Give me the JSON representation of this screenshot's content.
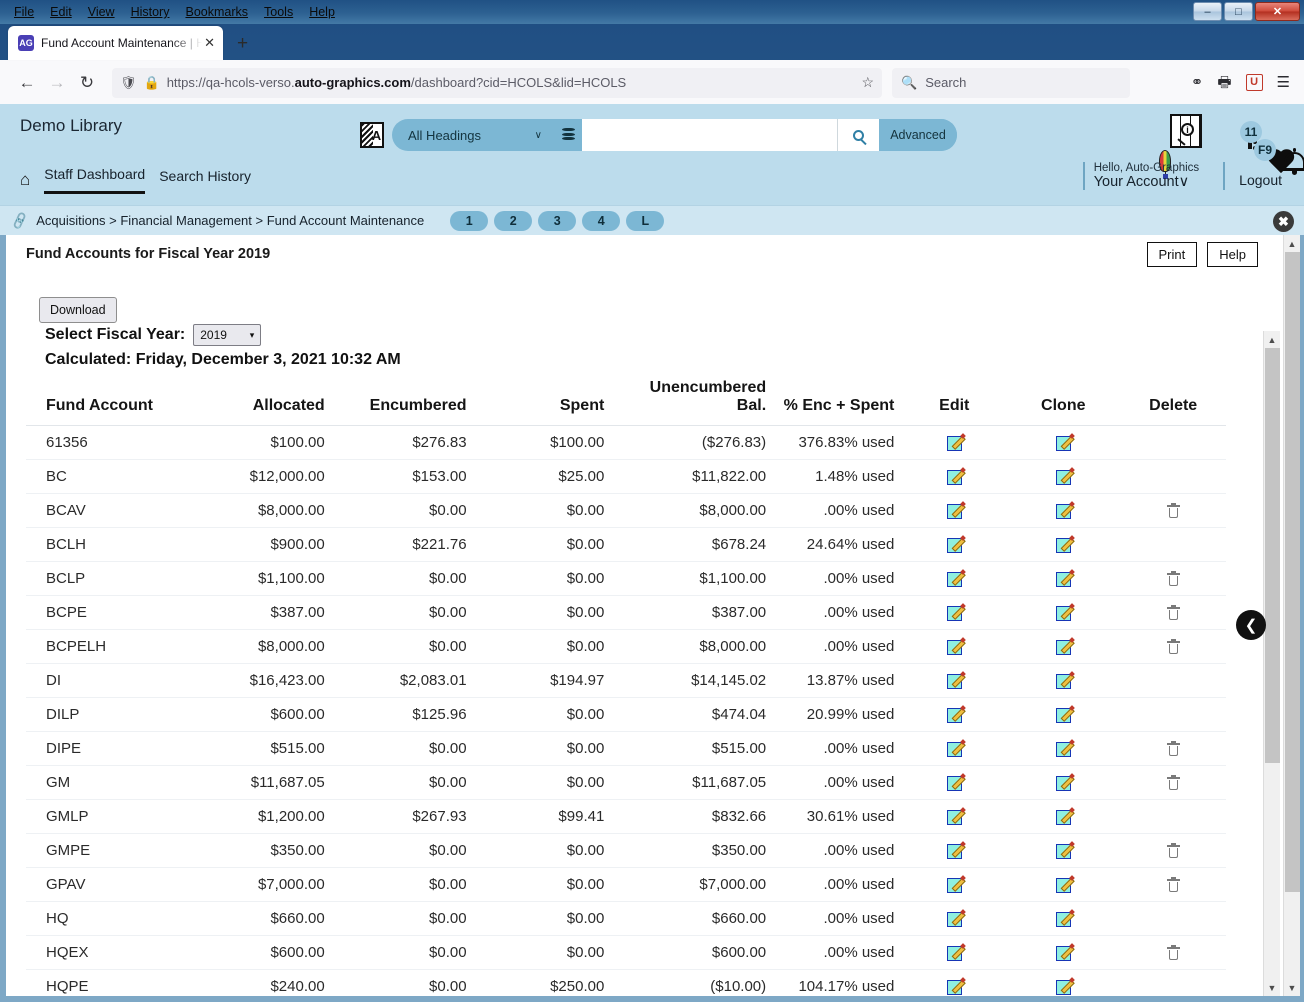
{
  "browser": {
    "menus": [
      "File",
      "Edit",
      "View",
      "History",
      "Bookmarks",
      "Tools",
      "Help"
    ],
    "window_controls": {
      "minimize": "–",
      "maximize": "□",
      "close": "✕"
    },
    "tab": {
      "title": "Fund Account Maintenance | HC",
      "close": "✕",
      "favicon_text": "AG"
    },
    "new_tab": "+",
    "nav": {
      "back": "←",
      "forward": "→",
      "reload": "↻"
    },
    "url": {
      "prefix": "https://qa-hcols-verso.",
      "bold": "auto-graphics.com",
      "suffix": "/dashboard?cid=HCOLS&lid=HCOLS"
    },
    "search": {
      "placeholder": "Search"
    },
    "star": "☆"
  },
  "app_header": {
    "brand": "Demo Library",
    "headings_select": "All Headings",
    "chevron": "∨",
    "search_value": "",
    "advanced_label": "Advanced",
    "lang_icon_letter": "A",
    "notifications_count": "11",
    "favorites_count": "F9"
  },
  "nav": {
    "home_icon": "⌂",
    "links": [
      {
        "label": "Staff Dashboard",
        "active": true
      },
      {
        "label": "Search History",
        "active": false
      }
    ]
  },
  "account": {
    "hello": "Hello, Auto-Graphics",
    "your_account": "Your Account",
    "caret": "∨",
    "logout": "Logout"
  },
  "breadcrumb": {
    "text": "Acquisitions > Financial Management > Fund Account Maintenance",
    "chips": [
      "1",
      "2",
      "3",
      "4",
      "L"
    ],
    "close": "✖"
  },
  "content": {
    "page_title": "Fund Accounts for Fiscal Year 2019",
    "print_label": "Print",
    "help_label": "Help",
    "download_label": "Download",
    "fiscal_year_label": "Select Fiscal Year:",
    "fiscal_year_value": "2019",
    "calculated_line": "Calculated: Friday, December 3, 2021 10:32 AM",
    "collapse_arrow": "❮"
  },
  "table": {
    "headers": {
      "account": "Fund Account",
      "allocated": "Allocated",
      "encumbered": "Encumbered",
      "spent": "Spent",
      "unencumbered": "Unencumbered Bal.",
      "pct": "% Enc + Spent",
      "edit": "Edit",
      "clone": "Clone",
      "delete": "Delete"
    },
    "rows": [
      {
        "account": "61356",
        "allocated": "$100.00",
        "encumbered": "$276.83",
        "spent": "$100.00",
        "unencumbered": "($276.83)",
        "pct": "376.83% used",
        "edit": true,
        "clone": true,
        "delete": false
      },
      {
        "account": "BC",
        "allocated": "$12,000.00",
        "encumbered": "$153.00",
        "spent": "$25.00",
        "unencumbered": "$11,822.00",
        "pct": "1.48% used",
        "edit": true,
        "clone": true,
        "delete": false
      },
      {
        "account": "BCAV",
        "allocated": "$8,000.00",
        "encumbered": "$0.00",
        "spent": "$0.00",
        "unencumbered": "$8,000.00",
        "pct": ".00% used",
        "edit": true,
        "clone": true,
        "delete": true
      },
      {
        "account": "BCLH",
        "allocated": "$900.00",
        "encumbered": "$221.76",
        "spent": "$0.00",
        "unencumbered": "$678.24",
        "pct": "24.64% used",
        "edit": true,
        "clone": true,
        "delete": false
      },
      {
        "account": "BCLP",
        "allocated": "$1,100.00",
        "encumbered": "$0.00",
        "spent": "$0.00",
        "unencumbered": "$1,100.00",
        "pct": ".00% used",
        "edit": true,
        "clone": true,
        "delete": true
      },
      {
        "account": "BCPE",
        "allocated": "$387.00",
        "encumbered": "$0.00",
        "spent": "$0.00",
        "unencumbered": "$387.00",
        "pct": ".00% used",
        "edit": true,
        "clone": true,
        "delete": true
      },
      {
        "account": "BCPELH",
        "allocated": "$8,000.00",
        "encumbered": "$0.00",
        "spent": "$0.00",
        "unencumbered": "$8,000.00",
        "pct": ".00% used",
        "edit": true,
        "clone": true,
        "delete": true
      },
      {
        "account": "DI",
        "allocated": "$16,423.00",
        "encumbered": "$2,083.01",
        "spent": "$194.97",
        "unencumbered": "$14,145.02",
        "pct": "13.87% used",
        "edit": true,
        "clone": true,
        "delete": false
      },
      {
        "account": "DILP",
        "allocated": "$600.00",
        "encumbered": "$125.96",
        "spent": "$0.00",
        "unencumbered": "$474.04",
        "pct": "20.99% used",
        "edit": true,
        "clone": true,
        "delete": false
      },
      {
        "account": "DIPE",
        "allocated": "$515.00",
        "encumbered": "$0.00",
        "spent": "$0.00",
        "unencumbered": "$515.00",
        "pct": ".00% used",
        "edit": true,
        "clone": true,
        "delete": true
      },
      {
        "account": "GM",
        "allocated": "$11,687.05",
        "encumbered": "$0.00",
        "spent": "$0.00",
        "unencumbered": "$11,687.05",
        "pct": ".00% used",
        "edit": true,
        "clone": true,
        "delete": true
      },
      {
        "account": "GMLP",
        "allocated": "$1,200.00",
        "encumbered": "$267.93",
        "spent": "$99.41",
        "unencumbered": "$832.66",
        "pct": "30.61% used",
        "edit": true,
        "clone": true,
        "delete": false
      },
      {
        "account": "GMPE",
        "allocated": "$350.00",
        "encumbered": "$0.00",
        "spent": "$0.00",
        "unencumbered": "$350.00",
        "pct": ".00% used",
        "edit": true,
        "clone": true,
        "delete": true
      },
      {
        "account": "GPAV",
        "allocated": "$7,000.00",
        "encumbered": "$0.00",
        "spent": "$0.00",
        "unencumbered": "$7,000.00",
        "pct": ".00% used",
        "edit": true,
        "clone": true,
        "delete": true
      },
      {
        "account": "HQ",
        "allocated": "$660.00",
        "encumbered": "$0.00",
        "spent": "$0.00",
        "unencumbered": "$660.00",
        "pct": ".00% used",
        "edit": true,
        "clone": true,
        "delete": false
      },
      {
        "account": "HQEX",
        "allocated": "$600.00",
        "encumbered": "$0.00",
        "spent": "$0.00",
        "unencumbered": "$600.00",
        "pct": ".00% used",
        "edit": true,
        "clone": true,
        "delete": true
      },
      {
        "account": "HQPE",
        "allocated": "$240.00",
        "encumbered": "$0.00",
        "spent": "$250.00",
        "unencumbered": "($10.00)",
        "pct": "104.17% used",
        "edit": true,
        "clone": true,
        "delete": false
      }
    ]
  },
  "colors": {
    "header_bg": "#bcdcec",
    "crumb_bg": "#cfe6f2",
    "accent": "#7cb7d4",
    "chrome_blue": "#2d6192",
    "edit_icon": "#8ff0e0"
  }
}
